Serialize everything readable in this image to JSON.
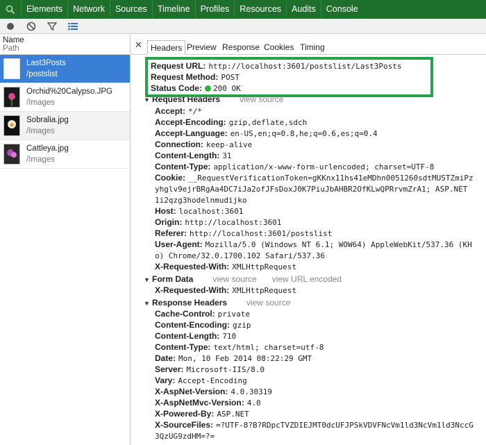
{
  "panel_tabs": [
    "Elements",
    "Network",
    "Sources",
    "Timeline",
    "Profiles",
    "Resources",
    "Audits",
    "Console"
  ],
  "left": {
    "header_name": "Name",
    "header_path": "Path",
    "rows": [
      {
        "name": "Last3Posts",
        "path": "/postslist"
      },
      {
        "name": "Orchid%20Calypso.JPG",
        "path": "/Images"
      },
      {
        "name": "Sobralia.jpg",
        "path": "/Images"
      },
      {
        "name": "Cattleya.jpg",
        "path": "/Images"
      }
    ]
  },
  "detail_tabs": [
    "Headers",
    "Preview",
    "Response",
    "Cookies",
    "Timing"
  ],
  "general": {
    "url_label": "Request URL:",
    "url": "http://localhost:3601/postslist/Last3Posts",
    "method_label": "Request Method:",
    "method": "POST",
    "status_label": "Status Code:",
    "status": "200 OK"
  },
  "request_headers": {
    "title": "Request Headers",
    "view_source": "view source",
    "items": [
      {
        "k": "Accept:",
        "v": "*/*"
      },
      {
        "k": "Accept-Encoding:",
        "v": "gzip,deflate,sdch"
      },
      {
        "k": "Accept-Language:",
        "v": "en-US,en;q=0.8,he;q=0.6,es;q=0.4"
      },
      {
        "k": "Connection:",
        "v": "keep-alive"
      },
      {
        "k": "Content-Length:",
        "v": "31"
      },
      {
        "k": "Content-Type:",
        "v": "application/x-www-form-urlencoded; charset=UTF-8"
      },
      {
        "k": "Cookie:",
        "v": "__RequestVerificationToken=gKKnx11hs41eMDhn0051260sdtMUSTZmiPz"
      },
      {
        "k": "",
        "v": "yhglv9ejrBRgAa4DC7iJa2ofJFsDoxJ0K7PiuJbAHBR2OfKLwQPRrvmZrA1; ASP.NET"
      },
      {
        "k": "",
        "v": "1i2qzg3hodelnmudijko"
      },
      {
        "k": "Host:",
        "v": "localhost:3601"
      },
      {
        "k": "Origin:",
        "v": "http://localhost:3601"
      },
      {
        "k": "Referer:",
        "v": "http://localhost:3601/postslist"
      },
      {
        "k": "User-Agent:",
        "v": "Mozilla/5.0 (Windows NT 6.1; WOW64) AppleWebKit/537.36 (KH"
      },
      {
        "k": "",
        "v": "o) Chrome/32.0.1700.102 Safari/537.36"
      },
      {
        "k": "X-Requested-With:",
        "v": "XMLHttpRequest"
      }
    ]
  },
  "form_data": {
    "title": "Form Data",
    "view_source": "view source",
    "view_url_encoded": "view URL encoded",
    "items": [
      {
        "k": "X-Requested-With:",
        "v": "XMLHttpRequest"
      }
    ]
  },
  "response_headers": {
    "title": "Response Headers",
    "view_source": "view source",
    "items": [
      {
        "k": "Cache-Control:",
        "v": "private"
      },
      {
        "k": "Content-Encoding:",
        "v": "gzip"
      },
      {
        "k": "Content-Length:",
        "v": "710"
      },
      {
        "k": "Content-Type:",
        "v": "text/html; charset=utf-8"
      },
      {
        "k": "Date:",
        "v": "Mon, 10 Feb 2014 08:22:29 GMT"
      },
      {
        "k": "Server:",
        "v": "Microsoft-IIS/8.0"
      },
      {
        "k": "Vary:",
        "v": "Accept-Encoding"
      },
      {
        "k": "X-AspNet-Version:",
        "v": "4.0.30319"
      },
      {
        "k": "X-AspNetMvc-Version:",
        "v": "4.0"
      },
      {
        "k": "X-Powered-By:",
        "v": "ASP.NET"
      },
      {
        "k": "X-SourceFiles:",
        "v": "=?UTF-8?B?RDpcTVZDIEJMT0dcUFJPSkVDVFNcVm1ld3NcVm1ld3NccG"
      },
      {
        "k": "",
        "v": "3QzUG9zdHM=?="
      }
    ]
  },
  "colors": {
    "accent_green": "#26a24a",
    "selection": "#3a7fd6",
    "toolbar_green": "#1f6f2c"
  }
}
